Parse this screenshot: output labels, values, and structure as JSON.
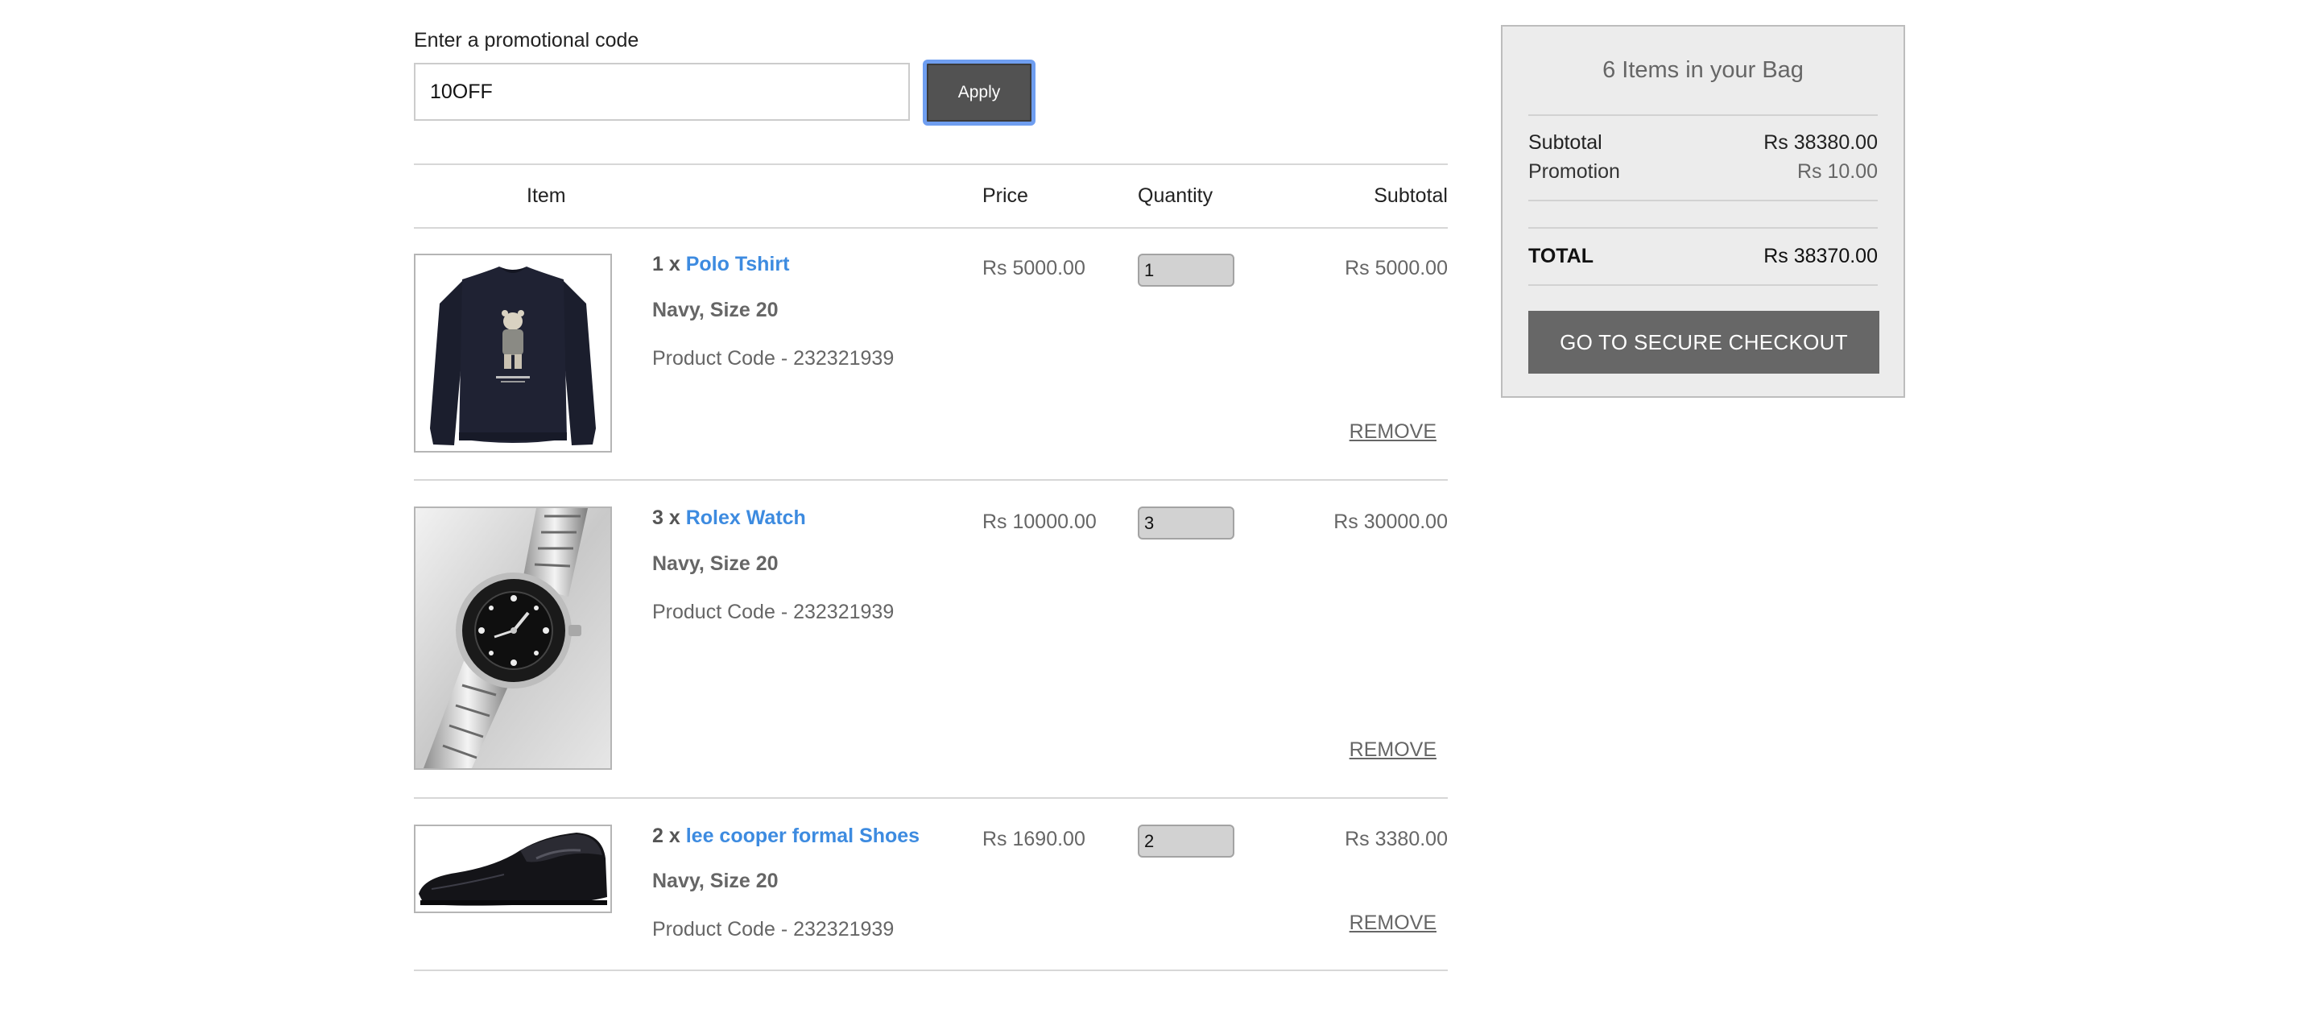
{
  "promo": {
    "label": "Enter a promotional code",
    "value": "10OFF",
    "apply_label": "Apply"
  },
  "table": {
    "headers": {
      "item": "Item",
      "price": "Price",
      "quantity": "Quantity",
      "subtotal": "Subtotal"
    },
    "rows": [
      {
        "qty_prefix": "1 x",
        "name": "Polo Tshirt",
        "variant": "Navy, Size 20",
        "code": "Product Code - 232321939",
        "price": "Rs 5000.00",
        "quantity": "1",
        "subtotal": "Rs 5000.00",
        "remove": "REMOVE",
        "image": "navy-sweatshirt-image"
      },
      {
        "qty_prefix": "3 x",
        "name": "Rolex Watch",
        "variant": "Navy, Size 20",
        "code": "Product Code - 232321939",
        "price": "Rs 10000.00",
        "quantity": "3",
        "subtotal": "Rs 30000.00",
        "remove": "REMOVE",
        "image": "wristwatch-image"
      },
      {
        "qty_prefix": "2 x",
        "name": "lee cooper formal Shoes",
        "variant": "Navy, Size 20",
        "code": "Product Code - 232321939",
        "price": "Rs 1690.00",
        "quantity": "2",
        "subtotal": "Rs 3380.00",
        "remove": "REMOVE",
        "image": "black-formal-shoe-image"
      }
    ]
  },
  "summary": {
    "title": "6 Items in your Bag",
    "subtotal_label": "Subtotal",
    "subtotal_value": "Rs 38380.00",
    "promotion_label": "Promotion",
    "promotion_value": "Rs 10.00",
    "total_label": "TOTAL",
    "total_value": "Rs 38370.00",
    "checkout_label": "GO TO SECURE CHECKOUT"
  },
  "colors": {
    "link": "#3d8be0",
    "apply_bg": "#525252",
    "apply_focus": "#6f9ef0",
    "checkout_bg": "#676767",
    "summary_bg": "#ececec"
  }
}
